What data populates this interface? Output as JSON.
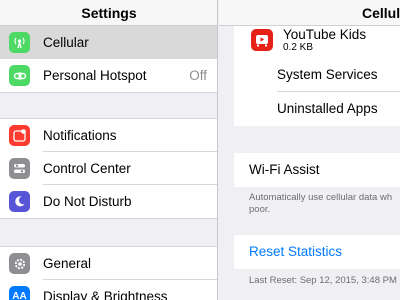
{
  "left": {
    "title": "Settings",
    "groups": [
      [
        {
          "label": "Cellular",
          "value": "",
          "icon": "cellular-antenna-icon",
          "color": "#4cd964",
          "selected": true
        },
        {
          "label": "Personal Hotspot",
          "value": "Off",
          "icon": "personal-hotspot-icon",
          "color": "#4cd964",
          "selected": false
        }
      ],
      [
        {
          "label": "Notifications",
          "value": "",
          "icon": "notifications-icon",
          "color": "#ff3b30",
          "selected": false
        },
        {
          "label": "Control Center",
          "value": "",
          "icon": "control-center-icon",
          "color": "#8e8e93",
          "selected": false
        },
        {
          "label": "Do Not Disturb",
          "value": "",
          "icon": "moon-icon",
          "color": "#5856d6",
          "selected": false
        }
      ],
      [
        {
          "label": "General",
          "value": "",
          "icon": "gear-icon",
          "color": "#8e8e93",
          "selected": false
        },
        {
          "label": "Display & Brightness",
          "value": "",
          "icon": "display-brightness-icon",
          "color": "#007aff",
          "selected": false
        }
      ]
    ]
  },
  "right": {
    "title": "Cellular",
    "app": {
      "name": "YouTube Kids",
      "size": "0.2 KB",
      "icon": "youtube-kids-icon",
      "color": "#e62117"
    },
    "usage_rows": [
      "System Services",
      "Uninstalled Apps"
    ],
    "wifi_assist": {
      "label": "Wi-Fi Assist",
      "footnote_line1": "Automatically use cellular data wh",
      "footnote_line2": "poor."
    },
    "reset": {
      "label": "Reset Statistics",
      "last_reset": "Last Reset: Sep 12, 2015, 3:48 PM"
    }
  }
}
